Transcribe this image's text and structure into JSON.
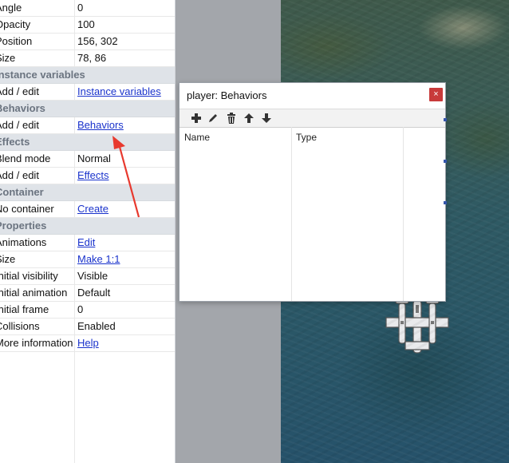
{
  "properties": {
    "rows": [
      {
        "type": "prop",
        "name": "Angle",
        "value": "0",
        "link": false
      },
      {
        "type": "prop",
        "name": "Opacity",
        "value": "100",
        "link": false
      },
      {
        "type": "prop",
        "name": "Position",
        "value": "156, 302",
        "link": false
      },
      {
        "type": "prop",
        "name": "Size",
        "value": "78, 86",
        "link": false
      },
      {
        "type": "cat",
        "name": "Instance variables"
      },
      {
        "type": "prop",
        "name": "Add / edit",
        "value": "Instance variables",
        "link": true
      },
      {
        "type": "cat",
        "name": "Behaviors"
      },
      {
        "type": "prop",
        "name": "Add / edit",
        "value": "Behaviors",
        "link": true
      },
      {
        "type": "cat",
        "name": "Effects"
      },
      {
        "type": "prop",
        "name": "Blend mode",
        "value": "Normal",
        "link": false
      },
      {
        "type": "prop",
        "name": "Add / edit",
        "value": "Effects",
        "link": true
      },
      {
        "type": "cat",
        "name": "Container"
      },
      {
        "type": "prop",
        "name": "No container",
        "value": "Create",
        "link": true
      },
      {
        "type": "cat",
        "name": "Properties"
      },
      {
        "type": "prop",
        "name": "Animations",
        "value": "Edit",
        "link": true
      },
      {
        "type": "prop",
        "name": "Size",
        "value": "Make 1:1",
        "link": true
      },
      {
        "type": "prop",
        "name": "Initial visibility",
        "value": "Visible",
        "link": false
      },
      {
        "type": "prop",
        "name": "Initial animation",
        "value": "Default",
        "link": false
      },
      {
        "type": "prop",
        "name": "Initial frame",
        "value": "0",
        "link": false
      },
      {
        "type": "prop",
        "name": "Collisions",
        "value": "Enabled",
        "link": false
      },
      {
        "type": "prop",
        "name": "More information",
        "value": "Help",
        "link": true
      }
    ]
  },
  "dialog": {
    "title": "player: Behaviors",
    "close_glyph": "×",
    "toolbar": [
      "add-icon",
      "edit-icon",
      "delete-icon",
      "move-up-icon",
      "move-down-icon"
    ],
    "columns": [
      "Name",
      "Type"
    ]
  },
  "colors": {
    "link": "#1a33cc",
    "category_bg": "#dfe3e8",
    "close_button": "#c83a3a",
    "arrow": "#e8392e"
  }
}
